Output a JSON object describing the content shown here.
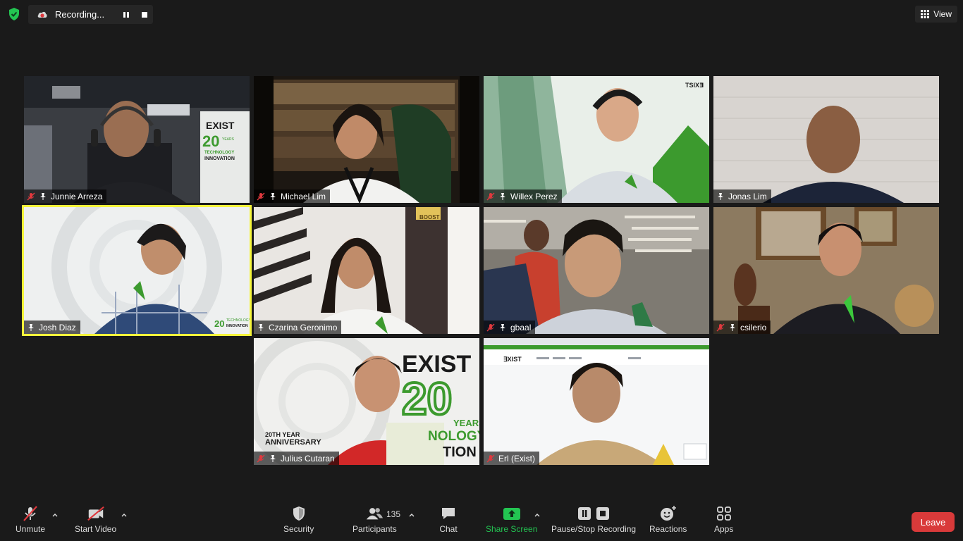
{
  "top": {
    "recording_label": "Recording...",
    "view_label": "View"
  },
  "tiles": [
    {
      "name": "Junnie Arreza",
      "muted": true
    },
    {
      "name": "Michael Lim",
      "muted": true
    },
    {
      "name": "Willex Perez",
      "muted": true
    },
    {
      "name": "Jonas Lim",
      "muted": false
    },
    {
      "name": "Josh Diaz",
      "muted": false,
      "active_speaker": true
    },
    {
      "name": "Czarina Geronimo",
      "muted": false
    },
    {
      "name": "gbaal",
      "muted": true
    },
    {
      "name": "csilerio",
      "muted": true
    },
    {
      "name": "Julius Cutaran",
      "muted": true
    },
    {
      "name": "Erl (Exist)",
      "muted": true
    }
  ],
  "backgrounds": {
    "exist_text": "EXIST",
    "years_20": "20",
    "years_label": "YEARS",
    "tech_label": "TECHNOLOGY",
    "innovation_label": "INNOVATION",
    "anniversary_line1": "20TH YEAR",
    "anniversary_line2": "ANNIVERSARY",
    "julius_nology": "NOLOGY",
    "julius_tion": "TION",
    "exist_logo_small": "TSIX∃",
    "boost_sign": "BOOST"
  },
  "toolbar": {
    "unmute": "Unmute",
    "start_video": "Start Video",
    "security": "Security",
    "participants": "Participants",
    "participants_count": "135",
    "chat": "Chat",
    "share_screen": "Share Screen",
    "pause_stop": "Pause/Stop Recording",
    "reactions": "Reactions",
    "apps": "Apps",
    "leave": "Leave"
  },
  "colors": {
    "background": "#1a1a1a",
    "active_outline": "#f5f53b",
    "share_green": "#23c552",
    "leave_red": "#d93a3a",
    "exist_green": "#3c9a2e",
    "muted_red": "#e0393e"
  }
}
